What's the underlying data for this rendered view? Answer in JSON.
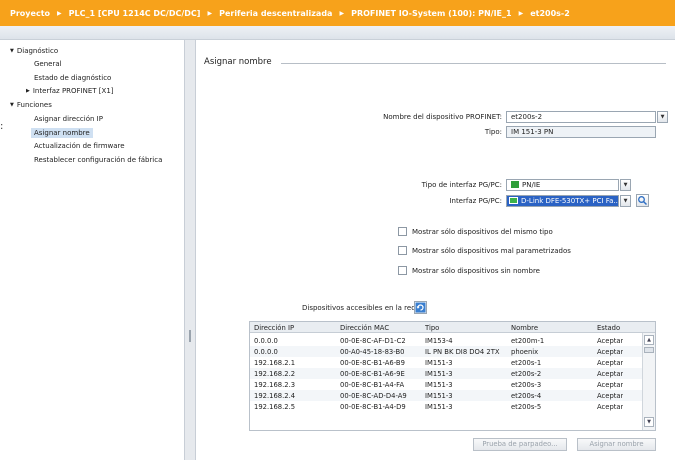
{
  "breadcrumb": [
    "Proyecto",
    "PLC_1 [CPU 1214C DC/DC/DC]",
    "Periferia descentralizada",
    "PROFINET IO-System (100): PN/IE_1",
    "et200s-2"
  ],
  "tree": {
    "diagnostico": "Diagnóstico",
    "general": "General",
    "estado": "Estado de diagnóstico",
    "interfaz": "Interfaz PROFINET [X1]",
    "funciones": "Funciones",
    "asignar_ip": "Asignar dirección IP",
    "asignar_nombre": "Asignar nombre",
    "firmware": "Actualización de firmware",
    "restablecer": "Restablecer configuración de fábrica"
  },
  "section_title": "Asignar nombre",
  "form": {
    "nombre_label": "Nombre del dispositivo PROFINET:",
    "nombre_value": "et200s-2",
    "tipo_label": "Tipo:",
    "tipo_value": "IM 151-3 PN",
    "tipo_if_label": "Tipo de interfaz PG/PC:",
    "tipo_if_value": "PN/IE",
    "interfaz_label": "Interfaz PG/PC:",
    "interfaz_value": "D-Link DFE-530TX+ PCI Fa..."
  },
  "checks": [
    "Mostrar sólo dispositivos del mismo tipo",
    "Mostrar sólo dispositivos mal parametrizados",
    "Mostrar sólo dispositivos sin nombre"
  ],
  "dispositivos_label": "Dispositivos accesibles en la red:",
  "table": {
    "headers": [
      "Dirección IP",
      "Dirección MAC",
      "Tipo",
      "Nombre",
      "Estado"
    ],
    "rows": [
      [
        "0.0.0.0",
        "00-0E-8C-AF-D1-C2",
        "IM153-4",
        "et200m-1",
        "Aceptar"
      ],
      [
        "0.0.0.0",
        "00-A0-45-18-83-B0",
        "IL PN BK DI8 DO4 2TX",
        "phoenix",
        "Aceptar"
      ],
      [
        "192.168.2.1",
        "00-0E-8C-B1-A6-B9",
        "IM151-3",
        "et200s-1",
        "Aceptar"
      ],
      [
        "192.168.2.2",
        "00-0E-8C-B1-A6-9E",
        "IM151-3",
        "et200s-2",
        "Aceptar"
      ],
      [
        "192.168.2.3",
        "00-0E-8C-B1-A4-FA",
        "IM151-3",
        "et200s-3",
        "Aceptar"
      ],
      [
        "192.168.2.4",
        "00-0E-8C-AD-D4-A9",
        "IM151-3",
        "et200s-4",
        "Aceptar"
      ],
      [
        "192.168.2.5",
        "00-0E-8C-B1-A4-D9",
        "IM151-3",
        "et200s-5",
        "Aceptar"
      ]
    ]
  },
  "buttons": {
    "parpadeo": "Prueba de parpadeo...",
    "asignar": "Asignar nombre"
  },
  "colors": {
    "breadcrumb_bg": "#f7a21b",
    "selection": "#2a62c4",
    "tree_selection": "#cfe0f2"
  }
}
